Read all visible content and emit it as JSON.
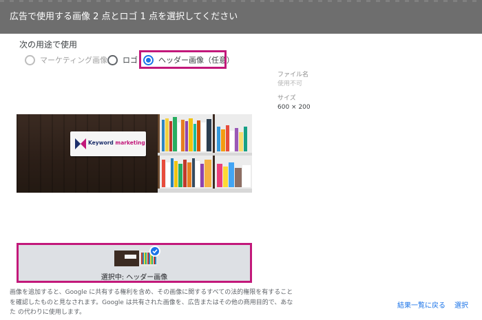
{
  "header": {
    "title": "広告で使用する画像 2 点とロゴ 1 点を選択してください"
  },
  "usage": {
    "label": "次の用途で使用",
    "options": [
      {
        "label": "マーケティング画像",
        "state": "disabled"
      },
      {
        "label": "ロゴ",
        "state": "unchecked"
      },
      {
        "label": "ヘッダー画像（任意）",
        "state": "checked"
      }
    ]
  },
  "file_info": {
    "filename_label": "ファイル名",
    "filename_value": "使用不可",
    "size_label": "サイズ",
    "size_value": "600 × 200"
  },
  "preview": {
    "sign_text_part1": "Keyword ",
    "sign_text_part2": "marketing"
  },
  "selection": {
    "label": "選択中: ヘッダー画像"
  },
  "disclaimer": {
    "line1": "画像を追加すると、Google に共有する権利を含め、その画像に関するすべての法的権限を有すること",
    "line2": "を確認したものと見なされます。Google は共有された画像を、広告またはその他の商用目的で、あな",
    "line3": "た の代わりに使用します。"
  },
  "actions": {
    "back_label": "結果一覧に戻る",
    "select_label": "選択"
  },
  "colors": {
    "accent": "#1a73e8",
    "highlight": "#c2187a",
    "header_bg": "#6e6e6e"
  }
}
